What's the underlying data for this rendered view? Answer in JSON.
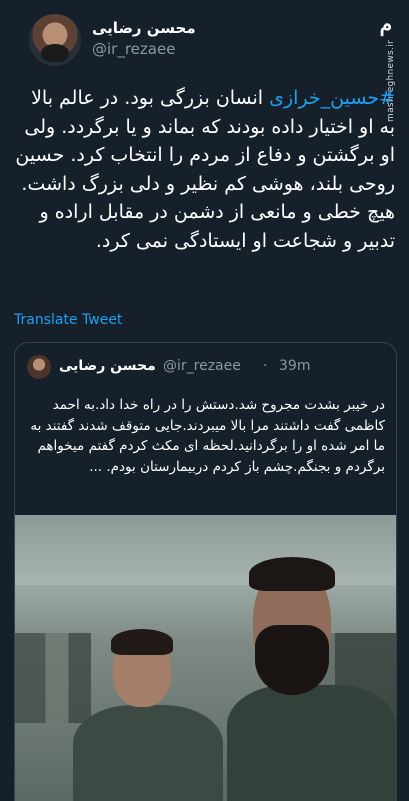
{
  "header": {
    "author_name": "محسن رضایی",
    "author_handle": "@ir_rezaee"
  },
  "brand": {
    "logo_text": "مشرق",
    "url": "mashreghnews.ir"
  },
  "tweet": {
    "hashtag": "#حسین_خرازی",
    "text": " انسان بزرگی بود. در عالم بالا به او اختیار داده بودند که بماند و یا برگردد. ولی او برگشتن و دفاع از مردم را انتخاب کرد.  حسین روحی بلند، هوشی کم نظیر و دلی بزرگ داشت. هیچ خطی و مانعی از دشمن در مقابل اراده و تدبیر و شجاعت او ایستادگی نمی کرد.",
    "translate_label": "Translate Tweet"
  },
  "quoted": {
    "author_name": "محسن رضایی",
    "author_handle": "@ir_rezaee",
    "separator": "·",
    "time": "39m",
    "text": "در خیبر بشدت مجروح شد.دستش را در راه خدا داد.به احمد کاظمی گفت داشتند مرا بالا میبردند.جایی متوقف شدند گفتند به ما امر شده او را برگردانید.لحظه ای مکث کردم گفتم میخواهم برگردم و بجنگم.چشم باز کردم دربیمارستان بودم. ..."
  },
  "colors": {
    "background": "#15202b",
    "accent": "#1da1f2",
    "muted": "#8899a6",
    "border": "#38444d"
  }
}
